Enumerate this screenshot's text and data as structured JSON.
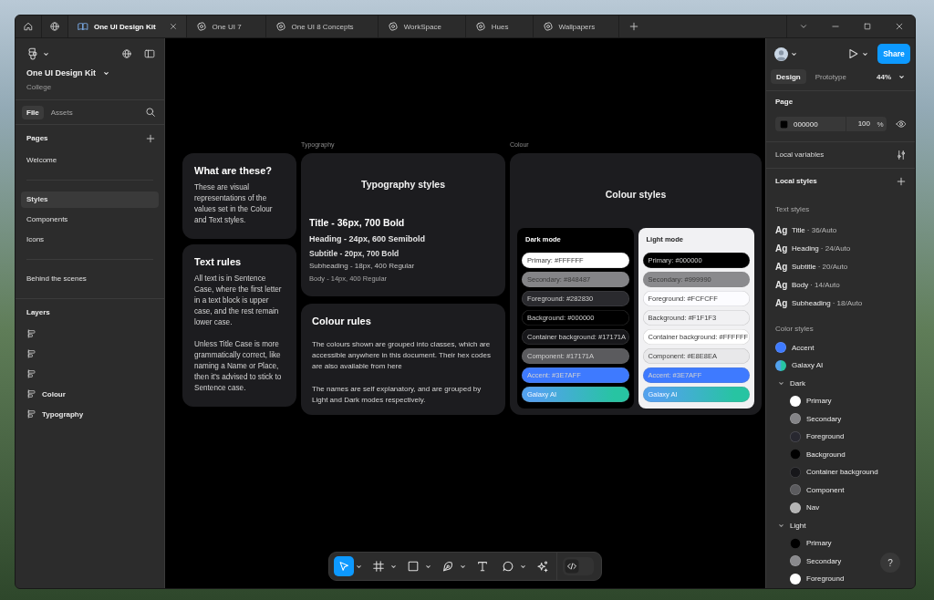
{
  "tab_bar": {
    "tabs": [
      {
        "label": "One UI Design Kit",
        "kind": "library",
        "selected": true
      },
      {
        "label": "One UI 7",
        "kind": "file",
        "selected": false
      },
      {
        "label": "One UI 8 Concepts",
        "kind": "file",
        "selected": false
      },
      {
        "label": "WorkSpace",
        "kind": "file",
        "selected": false
      },
      {
        "label": "Hues",
        "kind": "file",
        "selected": false
      },
      {
        "label": "Wallpapers",
        "kind": "file",
        "selected": false
      }
    ]
  },
  "sidebar": {
    "file_name": "One UI Design Kit",
    "team": "College",
    "tabs": [
      {
        "label": "File",
        "selected": true
      },
      {
        "label": "Assets",
        "selected": false
      }
    ],
    "pages_title": "Pages",
    "page_groups": [
      [
        {
          "label": "Welcome",
          "selected": false
        }
      ],
      [
        {
          "label": "Styles",
          "selected": true
        },
        {
          "label": "Components",
          "selected": false
        },
        {
          "label": "Icons",
          "selected": false
        }
      ],
      [
        {
          "label": "Behind the scenes",
          "selected": false
        }
      ]
    ],
    "layers_title": "Layers",
    "layers": [
      {
        "selected": false
      },
      {
        "selected": false
      },
      {
        "selected": false
      },
      {
        "name": "Colour",
        "selected": false
      },
      {
        "name": "Typography",
        "selected": false
      }
    ]
  },
  "canvas": {
    "info_cards": [
      {
        "title": "What are these?",
        "paragraphs": [
          "These are visual representations of the values set in the Colour and Text styles."
        ]
      },
      {
        "title": "Text rules",
        "paragraphs": [
          "All text is in Sentence Case, where the first letter in a text block is upper case, and the rest remain lower case.",
          "Unless Title Case is more grammatically correct, like naming a Name or Place, then it's advised to stick to Sentence case."
        ]
      }
    ],
    "typography": {
      "label": "Typography",
      "title": "Typography styles",
      "samples": [
        {
          "kind": "title",
          "text": "Title - 36px, 700 Bold"
        },
        {
          "kind": "heading",
          "text": "Heading - 24px, 600 Semibold"
        },
        {
          "kind": "subtitle",
          "text": "Subtitle - 20px, 700 Bold"
        },
        {
          "kind": "subheading",
          "text": "Subheading - 18px, 400 Regular"
        },
        {
          "kind": "body",
          "text": "Body - 14px, 400 Regular"
        }
      ]
    },
    "colour_rules": {
      "title": "Colour rules",
      "paragraphs": [
        "The colours shown are grouped into classes, which are accessible anywhere in this document. Their hex codes are also available from here",
        "The names are self explanatory, and are grouped by Light and Dark modes respectively."
      ]
    },
    "colour": {
      "label": "Colour",
      "title": "Colour styles",
      "modes": [
        {
          "kind": "dark",
          "title": "Dark mode",
          "swatches": [
            {
              "label": "Primary: #FFFFFF",
              "color": "#ffffff"
            },
            {
              "label": "Secondary: #848487",
              "color": "#848487"
            },
            {
              "label": "Foreground: #282830",
              "color": "#2a2a2e"
            },
            {
              "label": "Background: #000000",
              "color": "#000000"
            },
            {
              "label": "Container background: #17171A",
              "color": "#17171a"
            },
            {
              "label": "Component: #17171A",
              "color": "#5b5b5e"
            },
            {
              "label": "Accent: #3E7AFF",
              "color": "#3e7aff"
            },
            {
              "label": "Galaxy AI",
              "stops": [
                {
                  "color": "#52a2ee"
                },
                {
                  "color": "#27c4a2"
                }
              ]
            }
          ]
        },
        {
          "kind": "light",
          "title": "Light mode",
          "swatches": [
            {
              "label": "Primary: #000000",
              "color": "#000000"
            },
            {
              "label": "Secondary: #999990",
              "color": "#8a8a8d"
            },
            {
              "label": "Foreground: #FCFCFF",
              "color": "#fcfcff"
            },
            {
              "label": "Background: #F1F1F3",
              "color": "#f1f1f3"
            },
            {
              "label": "Container background: #FFFFFF",
              "color": "#ffffff"
            },
            {
              "label": "Component: #E8E8EA",
              "color": "#e8e8ea"
            },
            {
              "label": "Accent: #3E7AFF",
              "color": "#3e7aff"
            },
            {
              "label": "Galaxy AI",
              "stops": [
                {
                  "color": "#52a2ee"
                },
                {
                  "color": "#27c4a2"
                }
              ]
            }
          ]
        }
      ]
    }
  },
  "toolbar": {
    "tools": [
      {
        "kind": "move",
        "selected": true,
        "menu": true
      },
      {
        "kind": "frame",
        "selected": false,
        "menu": true
      },
      {
        "kind": "shape",
        "selected": false,
        "menu": true
      },
      {
        "kind": "pen",
        "selected": false,
        "menu": true
      },
      {
        "kind": "text",
        "selected": false,
        "menu": false
      },
      {
        "kind": "comment",
        "selected": false,
        "menu": true
      },
      {
        "kind": "actions",
        "selected": false,
        "menu": false
      }
    ],
    "dev_mode": false
  },
  "inspector": {
    "share": "Share",
    "tabs": [
      {
        "label": "Design",
        "selected": true
      },
      {
        "label": "Prototype",
        "selected": false
      }
    ],
    "zoom": "44%",
    "page": {
      "title": "Page",
      "color": "#000000",
      "hex": "000000",
      "opacity": "100",
      "unit": "%"
    },
    "local_variables": "Local variables",
    "local_styles": "Local styles",
    "text_styles": {
      "title": "Text styles",
      "items": [
        {
          "sample": "Ag",
          "name": "Title",
          "spec": "· 36/Auto"
        },
        {
          "sample": "Ag",
          "name": "Heading",
          "spec": "· 24/Auto"
        },
        {
          "sample": "Ag",
          "name": "Subtitle",
          "spec": "· 20/Auto"
        },
        {
          "sample": "Ag",
          "name": "Body",
          "spec": "· 14/Auto"
        },
        {
          "sample": "Ag",
          "name": "Subheading",
          "spec": "· 18/Auto"
        }
      ]
    },
    "color_styles": {
      "title": "Color styles",
      "items": [
        {
          "kind": "color",
          "name": "Accent",
          "color": "#3e7aff"
        },
        {
          "kind": "gradient",
          "name": "Galaxy AI",
          "stops": [
            {
              "color": "#52a2ee"
            },
            {
              "color": "#27c4a2"
            }
          ]
        },
        {
          "kind": "group",
          "name": "Dark",
          "expanded": true,
          "children": [
            {
              "name": "Primary",
              "color": "#ffffff"
            },
            {
              "name": "Secondary",
              "color": "#848487"
            },
            {
              "name": "Foreground",
              "color": "#282830"
            },
            {
              "name": "Background",
              "color": "#000000"
            },
            {
              "name": "Container background",
              "color": "#17171a"
            },
            {
              "name": "Component",
              "color": "#5b5b5e"
            },
            {
              "name": "Nav",
              "color": "#b4b4b4"
            }
          ]
        },
        {
          "kind": "group",
          "name": "Light",
          "expanded": true,
          "children": [
            {
              "name": "Primary",
              "color": "#000000"
            },
            {
              "name": "Secondary",
              "color": "#8a8a8d"
            },
            {
              "name": "Foreground",
              "color": "#ffffff"
            }
          ]
        }
      ]
    },
    "help": "?"
  }
}
